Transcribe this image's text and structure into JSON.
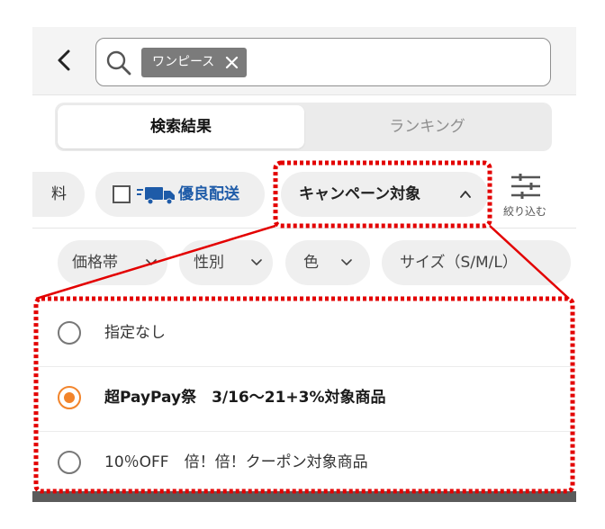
{
  "search": {
    "chip_label": "ワンピース"
  },
  "tabs": [
    {
      "label": "検索結果",
      "active": true
    },
    {
      "label": "ランキング",
      "active": false
    }
  ],
  "filters_row1": {
    "partial_label": "料",
    "delivery_label": "優良配送",
    "delivery_checked": false,
    "campaign_label": "キャンペーン対象",
    "refine_label": "絞り込む"
  },
  "filters_row2": [
    {
      "label": "価格帯"
    },
    {
      "label": "性別"
    },
    {
      "label": "色"
    },
    {
      "label": "サイズ（S/M/L）"
    }
  ],
  "dropdown": {
    "options": [
      {
        "label": "指定なし",
        "selected": false
      },
      {
        "label": "超PayPay祭　3/16〜21+3%対象商品",
        "selected": true
      },
      {
        "label": "10％OFF　倍！倍！クーポン対象商品",
        "selected": false
      }
    ]
  },
  "colors": {
    "selected_radio": "#f2842b",
    "delivery_text": "#1e5ba8",
    "annotation": "#e30000"
  }
}
